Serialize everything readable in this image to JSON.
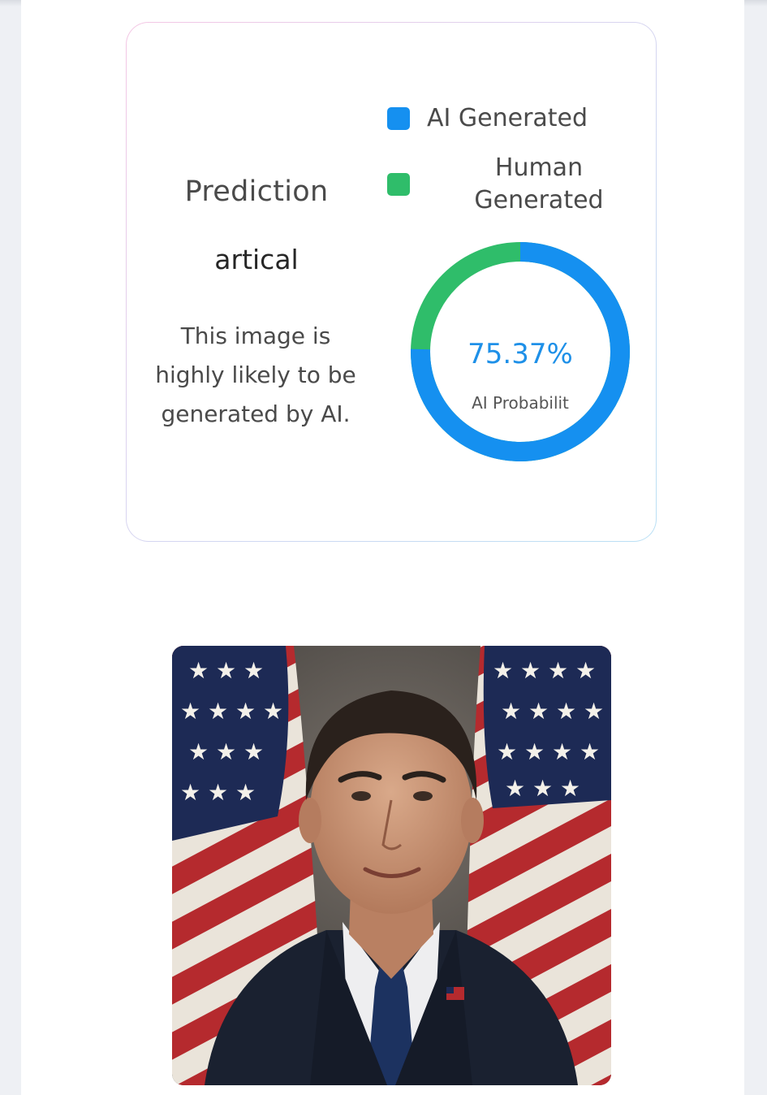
{
  "prediction": {
    "title": "Prediction",
    "value": "artical",
    "description": "This image is highly likely to be generated by AI."
  },
  "legend": {
    "ai_label": "AI Generated",
    "human_label_line1": "Human",
    "human_label_line2": "Generated"
  },
  "donut": {
    "ai_probability": 0.7537,
    "percent_text": "75.37%",
    "caption": "AI Probabilit"
  },
  "colors": {
    "ai": "#1590f0",
    "human": "#2fbd6a"
  },
  "portrait": {
    "alt": "portrait-photo",
    "icon": "person-with-flags-image"
  }
}
